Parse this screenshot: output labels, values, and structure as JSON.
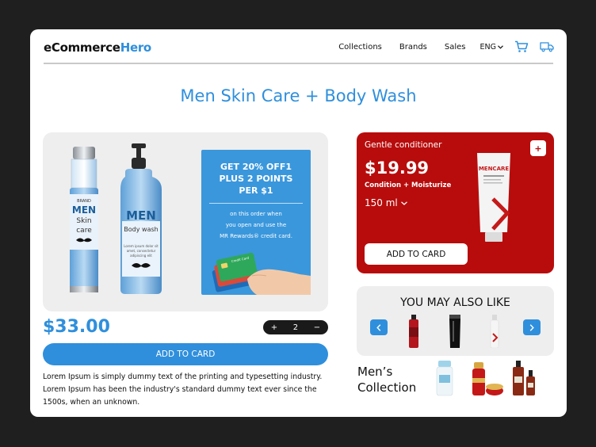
{
  "header": {
    "logo_main": "eCommerce",
    "logo_accent": "Hero",
    "nav": [
      "Collections",
      "Brands",
      "Sales"
    ],
    "language": "ENG"
  },
  "page_title": "Men Skin Care + Body Wash",
  "product": {
    "spray_label_brand": "BRAND",
    "spray_label_men": "MEN",
    "spray_label_skin": "Skin",
    "spray_label_care": "care",
    "bottle_label_men": "MEN",
    "bottle_label_body": "Body wash",
    "bottle_label_lorem": "Lorem ipsum dolor sit amet, consectetur adipiscing elit",
    "card_label": "Credit Card"
  },
  "promo": {
    "line1": "GET 20% OFF1",
    "line2": "PLUS 2 POINTS",
    "line3": "PER $1",
    "body1": "on this order when",
    "body2": "you open and use the",
    "body3": "MR Rewards® credit card."
  },
  "price": "$33.00",
  "quantity": {
    "minus": "−",
    "value": "2",
    "plus": "+"
  },
  "add_to_card_main": "ADD TO CARD",
  "description": "Lorem Ipsum is simply dummy text of the printing and typesetting industry. Lorem Ipsum has been the industry's standard dummy text ever since the 1500s, when an unknown.",
  "featured": {
    "title": "Gentle conditioner",
    "plus": "+",
    "price": "$19.99",
    "subtitle": "Condition + Moisturize",
    "size": "150 ml",
    "tube_brand": "MENCARE",
    "add_label": "ADD TO CARD"
  },
  "also_like": {
    "title": "YOU MAY ALSO LIKE"
  },
  "mens_collection": {
    "line1": "Men’s",
    "line2": "Collection"
  },
  "colors": {
    "accent": "#2f8fdc",
    "red": "#b80c0c",
    "dark": "#1f1f1f"
  }
}
